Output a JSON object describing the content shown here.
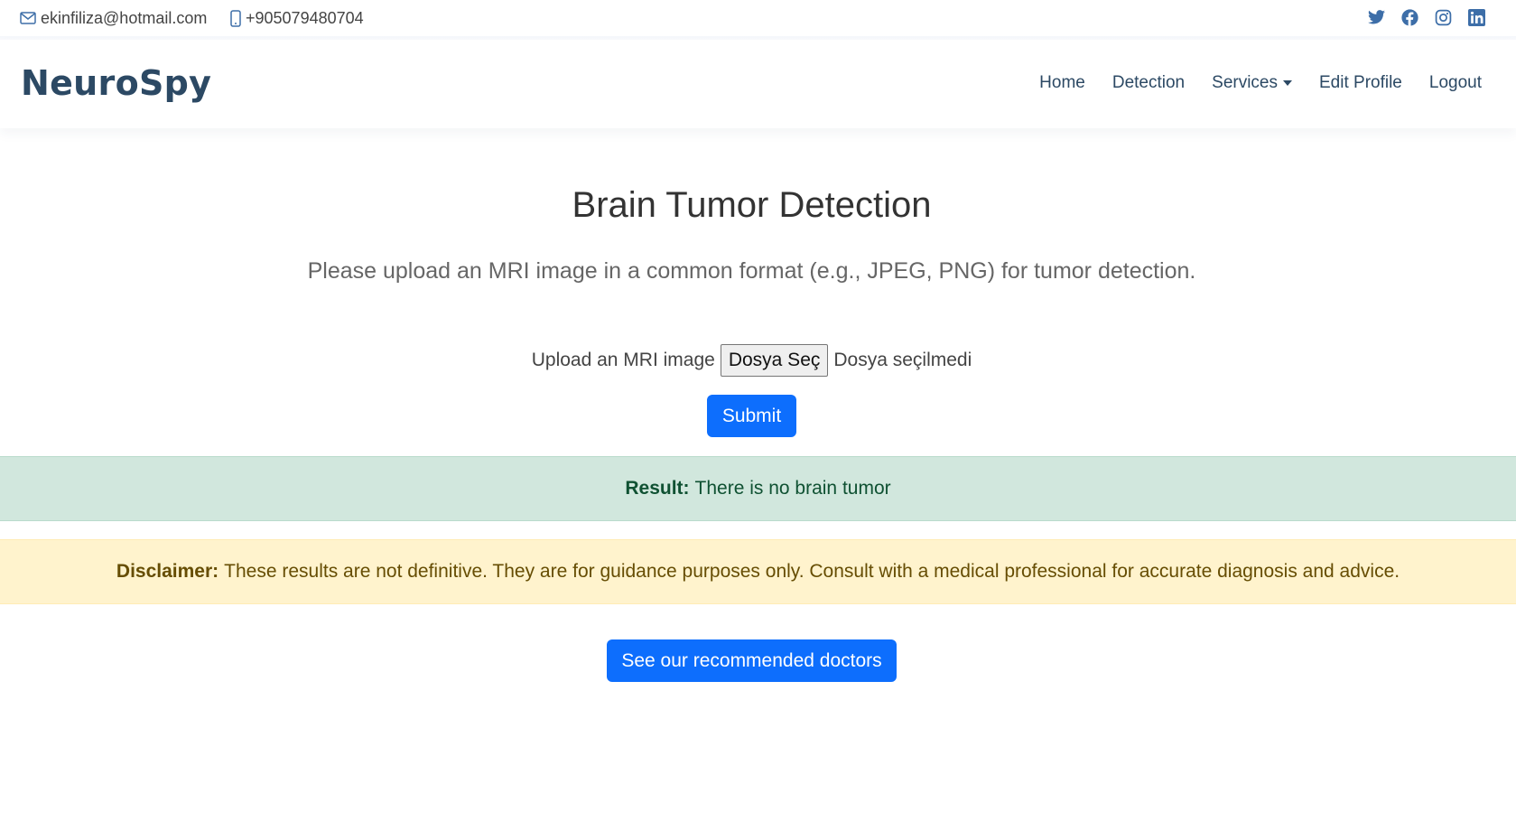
{
  "topbar": {
    "email": "ekinfiliza@hotmail.com",
    "phone": "+905079480704",
    "email_icon": "envelope-icon",
    "phone_icon": "phone-icon",
    "social": [
      "twitter-icon",
      "facebook-icon",
      "instagram-icon",
      "linkedin-icon"
    ]
  },
  "navbar": {
    "logo": "NeuroSpy",
    "links": [
      "Home",
      "Detection",
      "Services",
      "Edit Profile",
      "Logout"
    ]
  },
  "main": {
    "title": "Brain Tumor Detection",
    "subtitle": "Please upload an MRI image in a common format (e.g., JPEG, PNG) for tumor detection.",
    "upload_label": "Upload an MRI image",
    "file_button": "Dosya Seç",
    "file_status": "Dosya seçilmedi",
    "submit": "Submit"
  },
  "result": {
    "label": "Result:",
    "text": "There is no brain tumor"
  },
  "disclaimer": {
    "label": "Disclaimer:",
    "text": "These results are not definitive. They are for guidance purposes only. Consult with a medical professional for accurate diagnosis and advice."
  },
  "doctors_button": "See our recommended doctors",
  "colors": {
    "brand": "#2c4964",
    "primary": "#0d6efd",
    "success_bg": "#d1e7dd",
    "success_text": "#0f5132",
    "warning_bg": "#fff3cd",
    "warning_text": "#664d03"
  }
}
